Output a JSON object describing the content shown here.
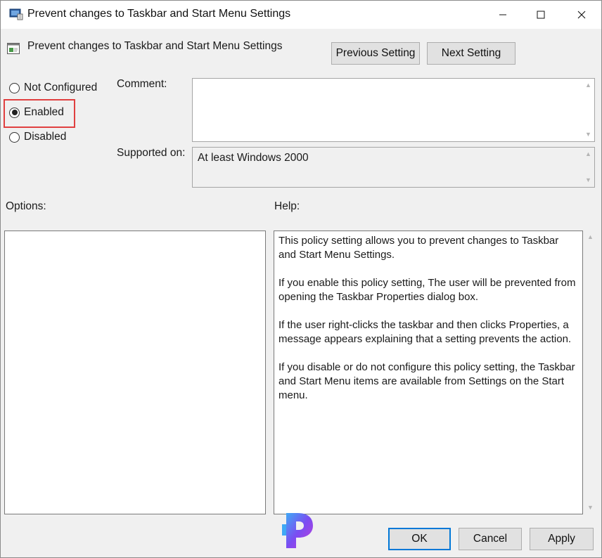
{
  "window": {
    "title": "Prevent changes to Taskbar and Start Menu Settings"
  },
  "header": {
    "title": "Prevent changes to Taskbar and Start Menu Settings"
  },
  "nav": {
    "previous_label": "Previous Setting",
    "next_label": "Next Setting"
  },
  "state": {
    "options": [
      {
        "label": "Not Configured",
        "selected": false
      },
      {
        "label": "Enabled",
        "selected": true
      },
      {
        "label": "Disabled",
        "selected": false
      }
    ]
  },
  "comment": {
    "label": "Comment:",
    "value": ""
  },
  "supported": {
    "label": "Supported on:",
    "value": "At least Windows 2000"
  },
  "options_panel": {
    "label": "Options:"
  },
  "help": {
    "label": "Help:",
    "paragraphs": [
      "This policy setting allows you to prevent changes to Taskbar and Start Menu Settings.",
      "If you enable this policy setting, The user will be prevented from opening the Taskbar Properties dialog box.",
      "If the user right-clicks the taskbar and then clicks Properties, a message appears explaining that a setting prevents the action.",
      "If you disable or do not configure this policy setting, the Taskbar and Start Menu items are available from Settings on the Start menu."
    ]
  },
  "footer": {
    "ok_label": "OK",
    "cancel_label": "Cancel",
    "apply_label": "Apply"
  },
  "colors": {
    "highlight": "#e04040",
    "focus": "#0078d7",
    "logo": "#8a3cf0"
  },
  "icons": [
    "policy-app-icon",
    "minimize-icon",
    "maximize-icon",
    "close-icon",
    "setting-icon",
    "watermark-logo-icon"
  ]
}
